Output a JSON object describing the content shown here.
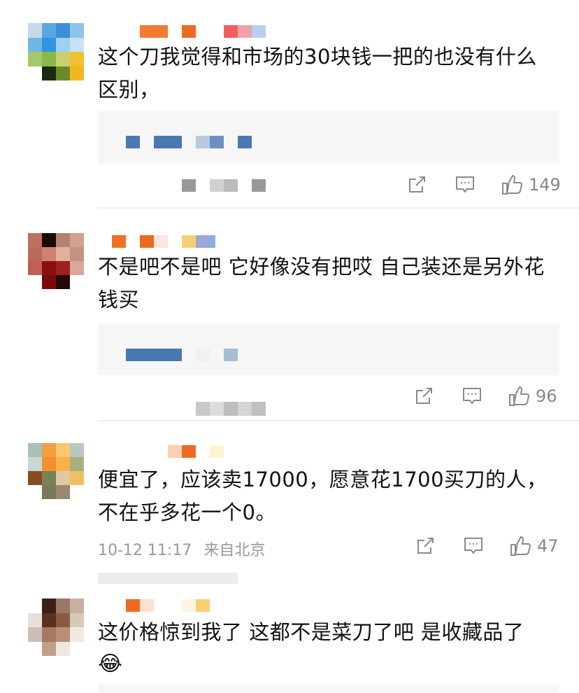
{
  "comments": [
    {
      "text_line1": "这个刀我觉得和市场的30块钱一把的也没有什么",
      "text_line2": "区别，",
      "like_count": "149"
    },
    {
      "text_line1": "不是吧不是吧 它好像没有把哎 自己装还是另外花",
      "text_line2": "钱买",
      "like_count": "96"
    },
    {
      "text_line1": "便宜了，应该卖17000，愿意花1700买刀的人，",
      "text_line2": "不在乎多花一个0。",
      "time": "10-12 11:17",
      "location": "来自北京",
      "like_count": "47"
    },
    {
      "text_line1": "这价格惊到我了 这都不是菜刀了吧 是收藏品了",
      "emoji": "😂"
    }
  ],
  "colors": {
    "accent_blue": "#4a78b0",
    "meta_gray": "#999999",
    "reply_bg": "#f6f6f6"
  },
  "icons": [
    "share-icon",
    "comment-icon",
    "like-icon"
  ]
}
